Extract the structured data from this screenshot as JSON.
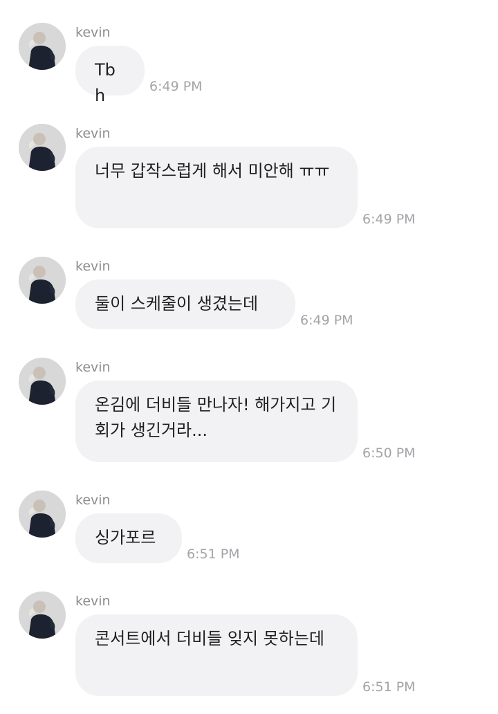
{
  "messages": [
    {
      "sender": "kevin",
      "text": "Tbh",
      "time": "6:49 PM"
    },
    {
      "sender": "kevin",
      "text": "너무 갑작스럽게 해서 미안해 ㅠㅠ",
      "time": "6:49 PM"
    },
    {
      "sender": "kevin",
      "text": "둘이 스케줄이 생겼는데",
      "time": "6:49 PM"
    },
    {
      "sender": "kevin",
      "text": "온김에 더비들 만나자! 해가지고 기회가 생긴거라...",
      "time": "6:50 PM"
    },
    {
      "sender": "kevin",
      "text": "싱가포르",
      "time": "6:51 PM"
    },
    {
      "sender": "kevin",
      "text": "콘서트에서 더비들 잊지 못하는데",
      "time": "6:51 PM"
    }
  ],
  "icons": {
    "avatar": "user-avatar-photo"
  },
  "colors": {
    "bubble": "#f2f2f4",
    "sender": "#8c8c90",
    "time": "#a3a3a8",
    "text": "#1f1f1f"
  }
}
